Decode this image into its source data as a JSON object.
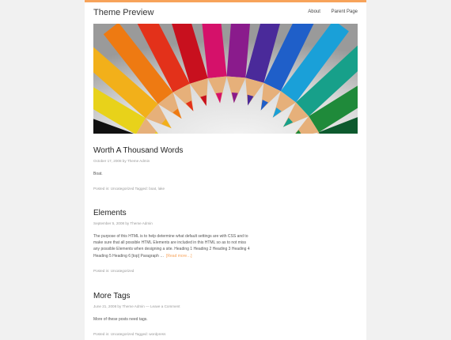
{
  "site": {
    "title": "Theme Preview"
  },
  "nav": [
    {
      "label": "About"
    },
    {
      "label": "Parent Page"
    }
  ],
  "posts": [
    {
      "title": "Worth A Thousand Words",
      "date": "October 17, 2008",
      "by": "by",
      "author": "Theme Admin",
      "excerpt": "Boat.",
      "posted_in": "Posted in:",
      "category": "Uncategorized",
      "tagged": "Tagged:",
      "tags": "boat, lake"
    },
    {
      "title": "Elements",
      "date": "September 5, 2008",
      "by": "by",
      "author": "Theme Admin",
      "excerpt_lines": [
        "The purpose of this HTML is to help determine what default settings are with CSS and to",
        "make sure that all possible HTML Elements are included in this HTML so as to not miss",
        "any possible Elements when designing a site. Heading 1 Heading 2 Heading 3 Heading 4",
        "Heading 5 Heading 6 [top] Paragraph …"
      ],
      "read_more": "[Read more…]",
      "posted_in": "Posted in:",
      "category": "Uncategorized"
    },
    {
      "title": "More Tags",
      "date": "June 21, 2008",
      "by": "by",
      "author": "Theme Admin",
      "dash": "—",
      "comment_link": "Leave a Comment",
      "excerpt": "More of these posts need tags.",
      "posted_in": "Posted in:",
      "category": "Uncategorized",
      "tagged": "Tagged:",
      "tags": "wordpress"
    }
  ],
  "colors": {
    "accent": "#f7a35a",
    "background": "#f1f1f1"
  },
  "hero_image": {
    "subject": "colored pencils fanned in a semicircle"
  }
}
